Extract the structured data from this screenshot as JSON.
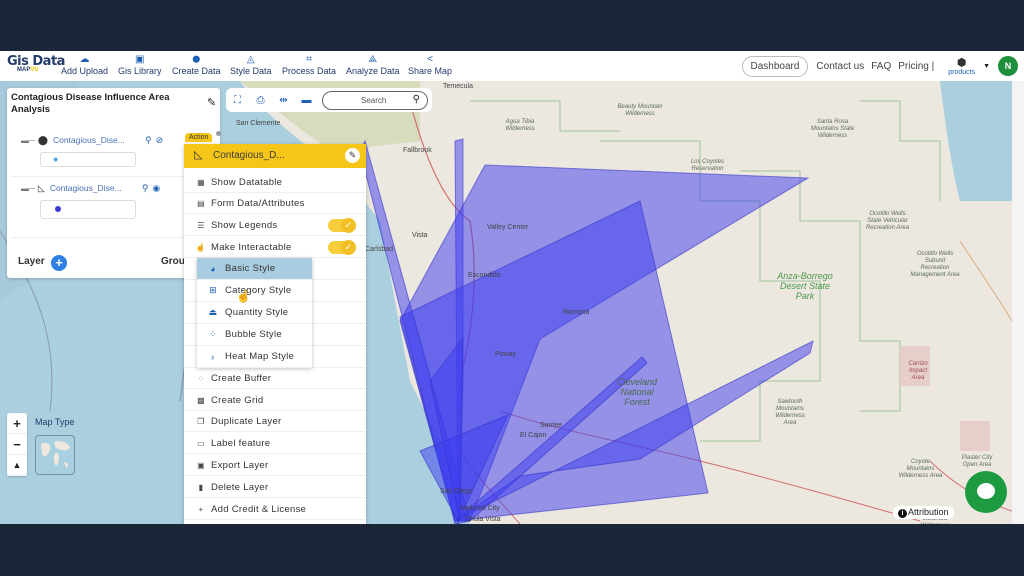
{
  "app": {
    "logo_main": "Gis Data",
    "logo_sub_a": "MAP",
    "logo_sub_b": "VU"
  },
  "nav": [
    {
      "label": "Add Upload",
      "icon": "cloud-upload-icon",
      "glyph": "☁"
    },
    {
      "label": "Gis Library",
      "icon": "library-icon",
      "glyph": "▣"
    },
    {
      "label": "Create Data",
      "icon": "location-pin-icon",
      "glyph": "⬤"
    },
    {
      "label": "Style Data",
      "icon": "paint-bucket-icon",
      "glyph": "◬"
    },
    {
      "label": "Process Data",
      "icon": "process-icon",
      "glyph": "⌗"
    },
    {
      "label": "Analyze Data",
      "icon": "analyze-icon",
      "glyph": "⟁"
    },
    {
      "label": "Share Map",
      "icon": "share-icon",
      "glyph": "<"
    }
  ],
  "right_nav": {
    "dashboard": "Dashboard",
    "contact": "Contact us",
    "faq": "FAQ",
    "pricing": "Pricing |",
    "products": "products",
    "avatar_initial": "N"
  },
  "layer_panel": {
    "title": "Contagious Disease Influence Area Analysis",
    "layers": [
      {
        "name": "Contagious_Dise...",
        "type": "point",
        "visible": false,
        "legend_color": "#4aa3df"
      },
      {
        "name": "Contagious_Dise...",
        "type": "polygon",
        "visible": true,
        "legend_color": "#3a3ad8"
      }
    ],
    "footer_layer": "Layer",
    "footer_group": "Grou"
  },
  "map_tools": {
    "search_placeholder": "Search"
  },
  "action_menu": {
    "tag": "Action",
    "layer_name": "Contagious_D...",
    "items": [
      {
        "label": "Show Datatable",
        "icon": "table-icon",
        "glyph": "▦"
      },
      {
        "label": "Form Data/Attributes",
        "icon": "form-icon",
        "glyph": "▤"
      },
      {
        "label": "Show Legends",
        "icon": "legend-list-icon",
        "glyph": "☰",
        "toggle": true
      },
      {
        "label": "Make Interactable",
        "icon": "pointer-hand-icon",
        "glyph": "☝",
        "toggle": true
      },
      {
        "label": "",
        "icon": "",
        "glyph": ""
      },
      {
        "label": "",
        "icon": "",
        "glyph": ""
      },
      {
        "label": "",
        "icon": "",
        "glyph": ""
      },
      {
        "label": "",
        "icon": "",
        "glyph": ""
      },
      {
        "label": "",
        "icon": "",
        "glyph": ""
      },
      {
        "label": "Create Buffer",
        "icon": "buffer-icon",
        "glyph": "◌"
      },
      {
        "label": "Create Grid",
        "icon": "grid-icon",
        "glyph": "▩"
      },
      {
        "label": "Duplicate Layer",
        "icon": "duplicate-icon",
        "glyph": "❐"
      },
      {
        "label": "Label feature",
        "icon": "label-icon",
        "glyph": "▭"
      },
      {
        "label": "Export Layer",
        "icon": "export-icon",
        "glyph": "▣"
      },
      {
        "label": "Delete Layer",
        "icon": "delete-icon",
        "glyph": "▮"
      },
      {
        "label": "Add Credit & License",
        "icon": "plus-icon",
        "glyph": "+"
      }
    ],
    "toggles": {
      "show_legends": true,
      "make_interactable": true
    }
  },
  "style_submenu": [
    {
      "label": "Basic Style",
      "icon": "basic-style-icon",
      "glyph": "◕",
      "active": true
    },
    {
      "label": "Category Style",
      "icon": "category-style-icon",
      "glyph": "⊞",
      "active": false
    },
    {
      "label": "Quantity Style",
      "icon": "quantity-style-icon",
      "glyph": "⏏",
      "active": false
    },
    {
      "label": "Bubble Style",
      "icon": "bubble-style-icon",
      "glyph": "⁘",
      "active": false
    },
    {
      "label": "Heat Map Style",
      "icon": "heatmap-style-icon",
      "glyph": "♁",
      "active": false
    }
  ],
  "map": {
    "map_type_label": "Map Type",
    "attribution": "Attribution",
    "polygon_color": "#3b3bf0",
    "labels": [
      {
        "text": "Temecula",
        "kind": "city"
      },
      {
        "text": "San Clemente",
        "kind": "city"
      },
      {
        "text": "Fallbrook",
        "kind": "city"
      },
      {
        "text": "Vista",
        "kind": "city"
      },
      {
        "text": "Carlsbad",
        "kind": "city"
      },
      {
        "text": "Valley Center",
        "kind": "city"
      },
      {
        "text": "Escondido",
        "kind": "city"
      },
      {
        "text": "Ramona",
        "kind": "city"
      },
      {
        "text": "Poway",
        "kind": "city"
      },
      {
        "text": "San Diego",
        "kind": "city"
      },
      {
        "text": "National City",
        "kind": "city"
      },
      {
        "text": "Chula Vista",
        "kind": "city"
      },
      {
        "text": "Santee",
        "kind": "city"
      },
      {
        "text": "El Cajon",
        "kind": "city"
      },
      {
        "text": "Cleveland National Forest",
        "kind": "park"
      },
      {
        "text": "Anza-Borrego Desert State Park",
        "kind": "park"
      },
      {
        "text": "Santa Rosa Mountains State Wilderness",
        "kind": "park"
      },
      {
        "text": "Agua Tibia Wilderness",
        "kind": "park"
      },
      {
        "text": "Beauty Mountain Wilderness",
        "kind": "park"
      },
      {
        "text": "Ocotillo Wells State Vehicular Recreation Area",
        "kind": "park"
      },
      {
        "text": "Ocotillo Wells Subunit Recreation Management Area",
        "kind": "park"
      },
      {
        "text": "Carrizo Impact Area",
        "kind": "restricted"
      },
      {
        "text": "Coyote Mountains Wilderness Area",
        "kind": "park"
      },
      {
        "text": "Plaster City Open Area",
        "kind": "park"
      },
      {
        "text": "Sawtooth Mountains Wilderness Area",
        "kind": "park"
      },
      {
        "text": "Jacumba Wilderness Area",
        "kind": "park"
      },
      {
        "text": "Los Coyotes Reservation",
        "kind": "park"
      }
    ]
  }
}
